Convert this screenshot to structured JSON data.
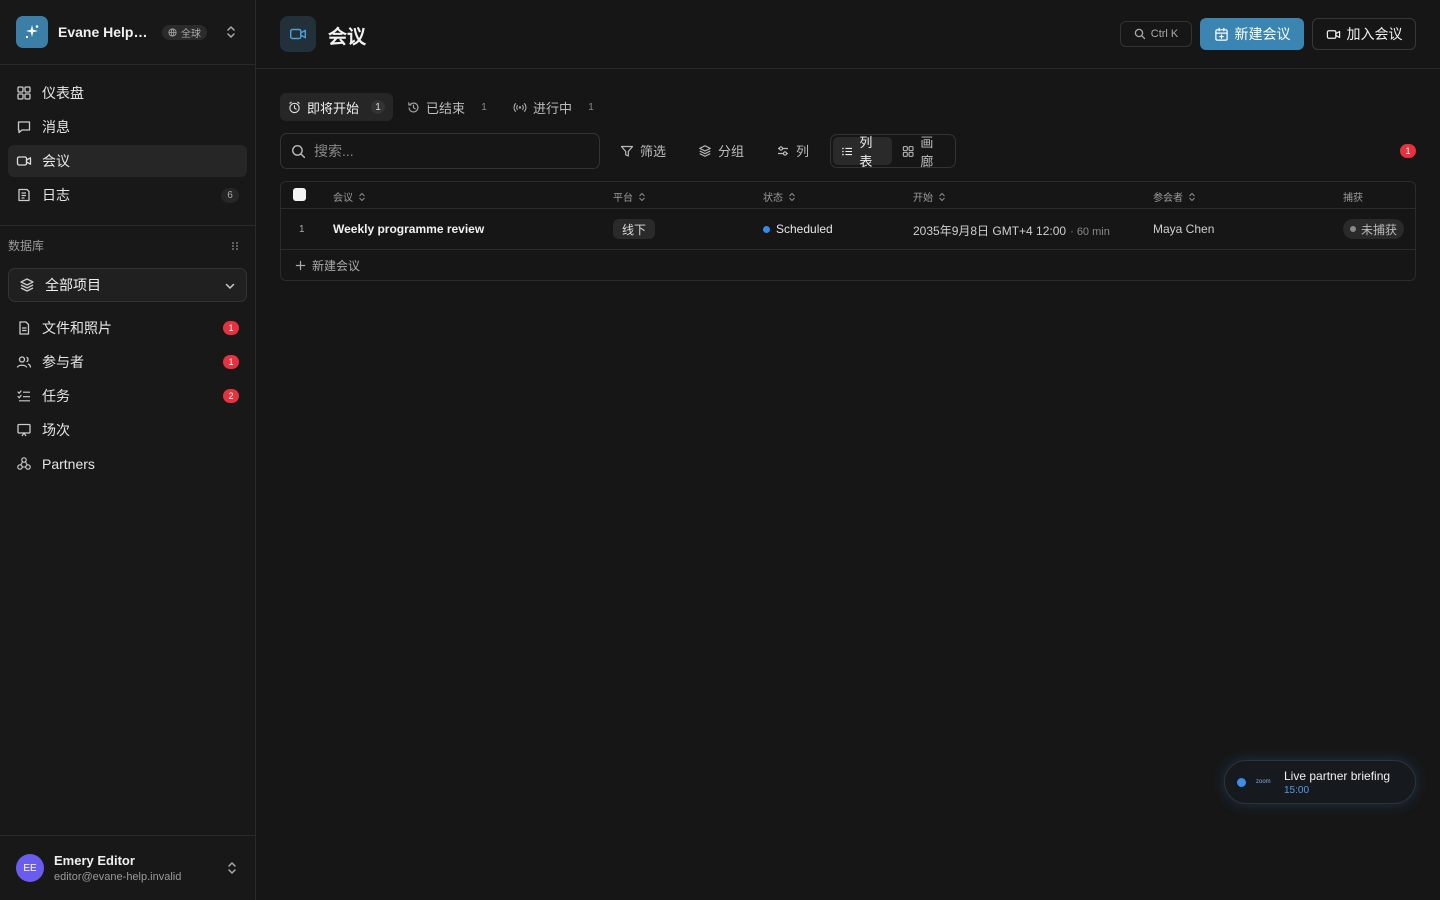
{
  "workspace": {
    "name": "Evane Help Center",
    "badge": "全球"
  },
  "sidebar": {
    "nav": [
      {
        "label": "仪表盘"
      },
      {
        "label": "消息"
      },
      {
        "label": "会议"
      },
      {
        "label": "日志",
        "count": "6"
      }
    ],
    "db_heading": "数据库",
    "project_select": "全部项目",
    "db_items": [
      {
        "label": "文件和照片",
        "badge": "1"
      },
      {
        "label": "参与者",
        "badge": "1"
      },
      {
        "label": "任务",
        "badge": "2"
      },
      {
        "label": "场次"
      },
      {
        "label": "Partners"
      }
    ]
  },
  "user": {
    "initials": "EE",
    "name": "Emery Editor",
    "email": "editor@evane-help.invalid"
  },
  "header": {
    "title": "会议",
    "search_shortcut": "Ctrl K",
    "new_button": "新建会议",
    "join_button": "加入会议"
  },
  "tabs": [
    {
      "label": "即将开始",
      "count": "1"
    },
    {
      "label": "已结束",
      "count": "1"
    },
    {
      "label": "进行中",
      "count": "1"
    }
  ],
  "toolbar": {
    "search_placeholder": "搜索...",
    "filter": "筛选",
    "group": "分组",
    "columns": "列",
    "view_list": "列表",
    "view_gallery": "画廊",
    "alert_count": "1"
  },
  "table": {
    "headers": {
      "meeting": "会议",
      "platform": "平台",
      "status": "状态",
      "start": "开始",
      "attendees": "参会者",
      "capture": "捕获"
    },
    "rows": [
      {
        "num": "1",
        "title": "Weekly programme review",
        "platform": "线下",
        "status": "Scheduled",
        "start": "2035年9月8日 GMT+4 12:00",
        "duration": "· 60 min",
        "attendees": "Maya Chen",
        "capture": "未捕获"
      }
    ],
    "add_row": "新建会议"
  },
  "toast": {
    "logo": "zoom",
    "title": "Live partner briefing",
    "time": "15:00"
  }
}
